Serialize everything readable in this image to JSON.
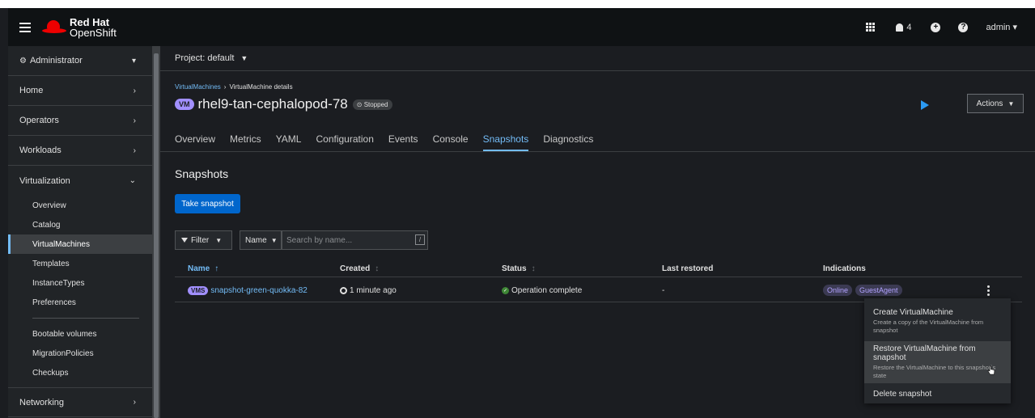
{
  "masthead": {
    "brand_line1": "Red Hat",
    "brand_line2": "OpenShift",
    "notification_count": "4",
    "user": "admin"
  },
  "sidebar": {
    "perspective": "Administrator",
    "sections": [
      "Home",
      "Operators",
      "Workloads",
      "Virtualization",
      "Networking"
    ],
    "virtualization_items": [
      "Overview",
      "Catalog",
      "VirtualMachines",
      "Templates",
      "InstanceTypes",
      "Preferences"
    ],
    "virtualization_items_2": [
      "Bootable volumes",
      "MigrationPolicies",
      "Checkups"
    ],
    "active_item": "VirtualMachines"
  },
  "project": {
    "label": "Project: default"
  },
  "breadcrumb": {
    "parent": "VirtualMachines",
    "current": "VirtualMachine details"
  },
  "vm": {
    "badge": "VM",
    "name": "rhel9-tan-cephalopod-78",
    "status": "Stopped"
  },
  "actions": {
    "label": "Actions"
  },
  "tabs": [
    "Overview",
    "Metrics",
    "YAML",
    "Configuration",
    "Events",
    "Console",
    "Snapshots",
    "Diagnostics"
  ],
  "active_tab": "Snapshots",
  "snapshots": {
    "title": "Snapshots",
    "take_button": "Take snapshot",
    "filter_label": "Filter",
    "name_select": "Name",
    "search_placeholder": "Search by name...",
    "search_shortcut": "/",
    "columns": [
      "Name",
      "Created",
      "Status",
      "Last restored",
      "Indications"
    ],
    "rows": [
      {
        "badge": "VMS",
        "name": "snapshot-green-quokka-82",
        "created": "1 minute ago",
        "status": "Operation complete",
        "last_restored": "-",
        "indications": [
          "Online",
          "GuestAgent"
        ]
      }
    ]
  },
  "menu": {
    "items": [
      {
        "title": "Create VirtualMachine",
        "desc": "Create a copy of the VirtualMachine from snapshot"
      },
      {
        "title": "Restore VirtualMachine from snapshot",
        "desc": "Restore the VirtualMachine to this snapshot`s state"
      },
      {
        "title": "Delete snapshot",
        "desc": ""
      }
    ]
  }
}
